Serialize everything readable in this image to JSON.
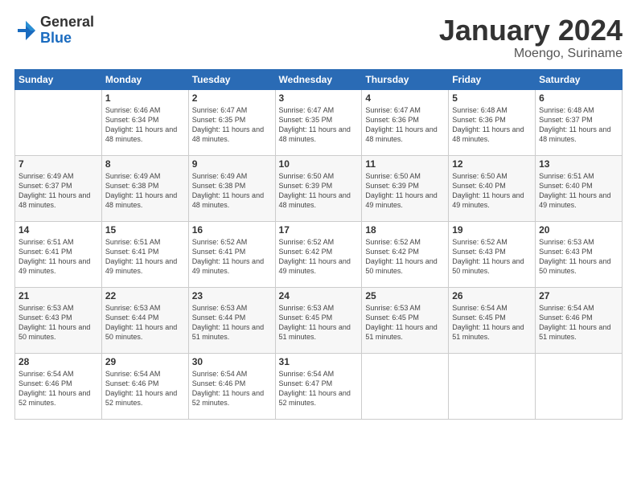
{
  "logo": {
    "general": "General",
    "blue": "Blue"
  },
  "title": {
    "month": "January 2024",
    "location": "Moengo, Suriname"
  },
  "weekdays": [
    "Sunday",
    "Monday",
    "Tuesday",
    "Wednesday",
    "Thursday",
    "Friday",
    "Saturday"
  ],
  "weeks": [
    [
      {
        "day": "",
        "sunrise": "",
        "sunset": "",
        "daylight": ""
      },
      {
        "day": "1",
        "sunrise": "Sunrise: 6:46 AM",
        "sunset": "Sunset: 6:34 PM",
        "daylight": "Daylight: 11 hours and 48 minutes."
      },
      {
        "day": "2",
        "sunrise": "Sunrise: 6:47 AM",
        "sunset": "Sunset: 6:35 PM",
        "daylight": "Daylight: 11 hours and 48 minutes."
      },
      {
        "day": "3",
        "sunrise": "Sunrise: 6:47 AM",
        "sunset": "Sunset: 6:35 PM",
        "daylight": "Daylight: 11 hours and 48 minutes."
      },
      {
        "day": "4",
        "sunrise": "Sunrise: 6:47 AM",
        "sunset": "Sunset: 6:36 PM",
        "daylight": "Daylight: 11 hours and 48 minutes."
      },
      {
        "day": "5",
        "sunrise": "Sunrise: 6:48 AM",
        "sunset": "Sunset: 6:36 PM",
        "daylight": "Daylight: 11 hours and 48 minutes."
      },
      {
        "day": "6",
        "sunrise": "Sunrise: 6:48 AM",
        "sunset": "Sunset: 6:37 PM",
        "daylight": "Daylight: 11 hours and 48 minutes."
      }
    ],
    [
      {
        "day": "7",
        "sunrise": "Sunrise: 6:49 AM",
        "sunset": "Sunset: 6:37 PM",
        "daylight": "Daylight: 11 hours and 48 minutes."
      },
      {
        "day": "8",
        "sunrise": "Sunrise: 6:49 AM",
        "sunset": "Sunset: 6:38 PM",
        "daylight": "Daylight: 11 hours and 48 minutes."
      },
      {
        "day": "9",
        "sunrise": "Sunrise: 6:49 AM",
        "sunset": "Sunset: 6:38 PM",
        "daylight": "Daylight: 11 hours and 48 minutes."
      },
      {
        "day": "10",
        "sunrise": "Sunrise: 6:50 AM",
        "sunset": "Sunset: 6:39 PM",
        "daylight": "Daylight: 11 hours and 48 minutes."
      },
      {
        "day": "11",
        "sunrise": "Sunrise: 6:50 AM",
        "sunset": "Sunset: 6:39 PM",
        "daylight": "Daylight: 11 hours and 49 minutes."
      },
      {
        "day": "12",
        "sunrise": "Sunrise: 6:50 AM",
        "sunset": "Sunset: 6:40 PM",
        "daylight": "Daylight: 11 hours and 49 minutes."
      },
      {
        "day": "13",
        "sunrise": "Sunrise: 6:51 AM",
        "sunset": "Sunset: 6:40 PM",
        "daylight": "Daylight: 11 hours and 49 minutes."
      }
    ],
    [
      {
        "day": "14",
        "sunrise": "Sunrise: 6:51 AM",
        "sunset": "Sunset: 6:41 PM",
        "daylight": "Daylight: 11 hours and 49 minutes."
      },
      {
        "day": "15",
        "sunrise": "Sunrise: 6:51 AM",
        "sunset": "Sunset: 6:41 PM",
        "daylight": "Daylight: 11 hours and 49 minutes."
      },
      {
        "day": "16",
        "sunrise": "Sunrise: 6:52 AM",
        "sunset": "Sunset: 6:41 PM",
        "daylight": "Daylight: 11 hours and 49 minutes."
      },
      {
        "day": "17",
        "sunrise": "Sunrise: 6:52 AM",
        "sunset": "Sunset: 6:42 PM",
        "daylight": "Daylight: 11 hours and 49 minutes."
      },
      {
        "day": "18",
        "sunrise": "Sunrise: 6:52 AM",
        "sunset": "Sunset: 6:42 PM",
        "daylight": "Daylight: 11 hours and 50 minutes."
      },
      {
        "day": "19",
        "sunrise": "Sunrise: 6:52 AM",
        "sunset": "Sunset: 6:43 PM",
        "daylight": "Daylight: 11 hours and 50 minutes."
      },
      {
        "day": "20",
        "sunrise": "Sunrise: 6:53 AM",
        "sunset": "Sunset: 6:43 PM",
        "daylight": "Daylight: 11 hours and 50 minutes."
      }
    ],
    [
      {
        "day": "21",
        "sunrise": "Sunrise: 6:53 AM",
        "sunset": "Sunset: 6:43 PM",
        "daylight": "Daylight: 11 hours and 50 minutes."
      },
      {
        "day": "22",
        "sunrise": "Sunrise: 6:53 AM",
        "sunset": "Sunset: 6:44 PM",
        "daylight": "Daylight: 11 hours and 50 minutes."
      },
      {
        "day": "23",
        "sunrise": "Sunrise: 6:53 AM",
        "sunset": "Sunset: 6:44 PM",
        "daylight": "Daylight: 11 hours and 51 minutes."
      },
      {
        "day": "24",
        "sunrise": "Sunrise: 6:53 AM",
        "sunset": "Sunset: 6:45 PM",
        "daylight": "Daylight: 11 hours and 51 minutes."
      },
      {
        "day": "25",
        "sunrise": "Sunrise: 6:53 AM",
        "sunset": "Sunset: 6:45 PM",
        "daylight": "Daylight: 11 hours and 51 minutes."
      },
      {
        "day": "26",
        "sunrise": "Sunrise: 6:54 AM",
        "sunset": "Sunset: 6:45 PM",
        "daylight": "Daylight: 11 hours and 51 minutes."
      },
      {
        "day": "27",
        "sunrise": "Sunrise: 6:54 AM",
        "sunset": "Sunset: 6:46 PM",
        "daylight": "Daylight: 11 hours and 51 minutes."
      }
    ],
    [
      {
        "day": "28",
        "sunrise": "Sunrise: 6:54 AM",
        "sunset": "Sunset: 6:46 PM",
        "daylight": "Daylight: 11 hours and 52 minutes."
      },
      {
        "day": "29",
        "sunrise": "Sunrise: 6:54 AM",
        "sunset": "Sunset: 6:46 PM",
        "daylight": "Daylight: 11 hours and 52 minutes."
      },
      {
        "day": "30",
        "sunrise": "Sunrise: 6:54 AM",
        "sunset": "Sunset: 6:46 PM",
        "daylight": "Daylight: 11 hours and 52 minutes."
      },
      {
        "day": "31",
        "sunrise": "Sunrise: 6:54 AM",
        "sunset": "Sunset: 6:47 PM",
        "daylight": "Daylight: 11 hours and 52 minutes."
      },
      {
        "day": "",
        "sunrise": "",
        "sunset": "",
        "daylight": ""
      },
      {
        "day": "",
        "sunrise": "",
        "sunset": "",
        "daylight": ""
      },
      {
        "day": "",
        "sunrise": "",
        "sunset": "",
        "daylight": ""
      }
    ]
  ]
}
